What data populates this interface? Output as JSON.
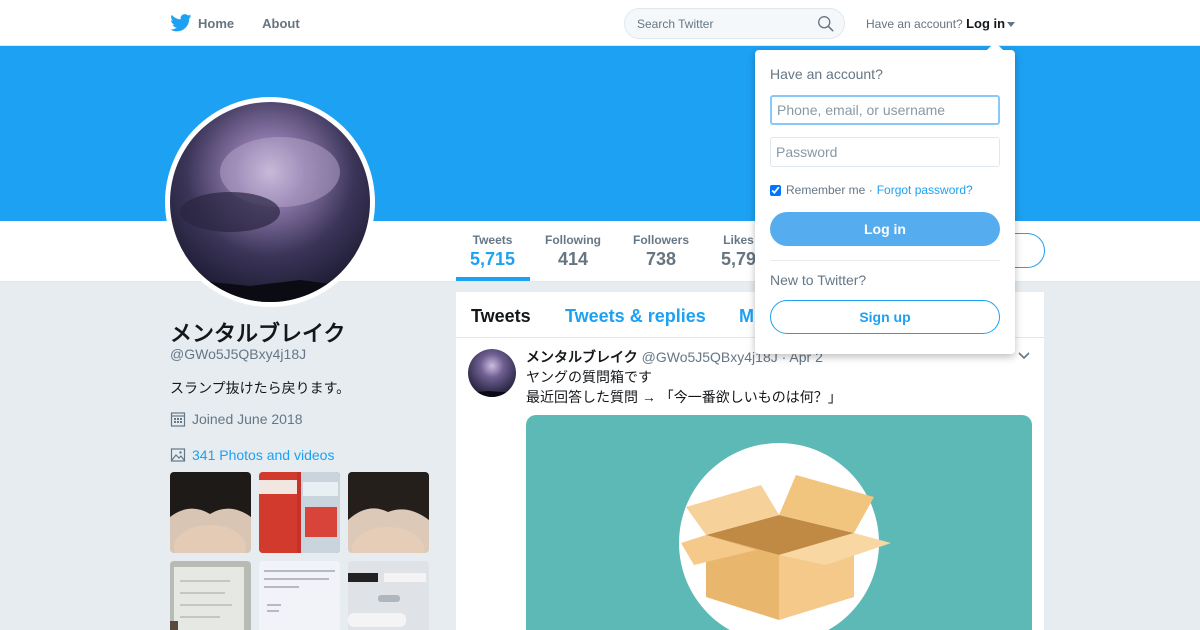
{
  "nav": {
    "home_label": "Home",
    "about_label": "About",
    "search_placeholder": "Search Twitter",
    "have_account_text": "Have an account?",
    "login_label": "Log in"
  },
  "profile": {
    "name": "メンタルブレイク",
    "screen_name": "@GWo5J5QBxy4j18J",
    "bio": "スランプ抜けたら戻ります。",
    "joined": "Joined June 2018",
    "photos_label": "341 Photos and videos"
  },
  "stats": [
    {
      "label": "Tweets",
      "value": "5,715"
    },
    {
      "label": "Following",
      "value": "414"
    },
    {
      "label": "Followers",
      "value": "738"
    },
    {
      "label": "Likes",
      "value": "5,79"
    }
  ],
  "timeline": {
    "tabs": [
      "Tweets",
      "Tweets & replies",
      "M"
    ],
    "tweet": {
      "name": "メンタルブレイク",
      "handle": "@GWo5J5QBxy4j18J",
      "date": "· Apr 2",
      "lines": [
        "ヤングの質問箱です",
        "最近回答した質問 → 「今一番欲しいものは何？」"
      ]
    }
  },
  "login_dropdown": {
    "title": "Have an account?",
    "username_placeholder": "Phone, email, or username",
    "password_placeholder": "Password",
    "remember_label": "Remember me ·",
    "forgot_label": "Forgot password?",
    "login_button": "Log in",
    "new_text": "New to Twitter?",
    "signup_button": "Sign up"
  },
  "colors": {
    "accent": "#1da1f2",
    "banner": "#1da1f2",
    "card_bg": "#5db9b5",
    "login_button": "#55acee"
  },
  "icons": [
    "twitter-bird-icon",
    "search-icon",
    "calendar-icon",
    "photo-icon",
    "chevron-down-icon",
    "caret-down-icon"
  ]
}
